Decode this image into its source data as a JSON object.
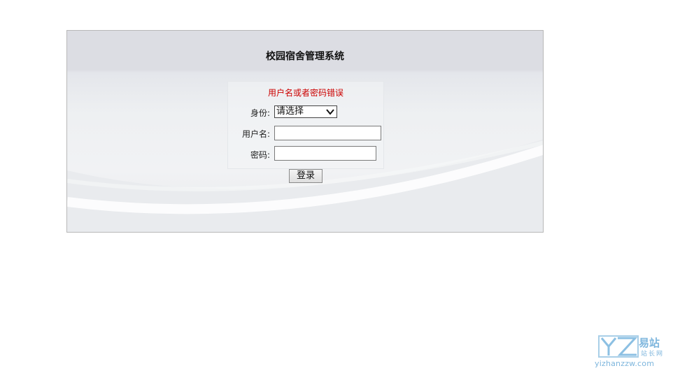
{
  "app": {
    "title": "校园宿舍管理系统"
  },
  "login": {
    "error_message": "用户名或者密码错误",
    "role_label": "身份:",
    "role_selected": "请选择",
    "username_label": "用户名:",
    "username_value": "",
    "password_label": "密码:",
    "password_value": "",
    "submit_label": "登录"
  },
  "watermark": {
    "brand_cn_1": "易站",
    "brand_cn_2": "站长网",
    "domain": "yizhanzzw.com",
    "color": "#7eb6dd"
  },
  "colors": {
    "error": "#cc0000",
    "panel_border": "#b8b8b8",
    "header_band": "#dcdde3"
  }
}
